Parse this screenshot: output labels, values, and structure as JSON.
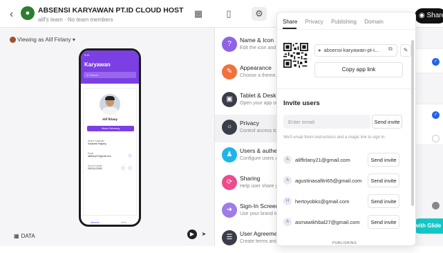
{
  "header": {
    "app_title": "ABSENSI KARYAWAN PT.ID CLOUD HOST",
    "app_subtitle": "alif's team · No team members",
    "publish_label": "Share"
  },
  "viewer": {
    "viewing_as": "Viewing as Alif Firlany"
  },
  "phone": {
    "time": "9:41",
    "screen_title": "Karyawan",
    "search_placeholder": "Search",
    "employee_name": "Alif firlany",
    "action_button": "Absen Sekarang",
    "rows": [
      {
        "label": "Status Karyawan",
        "value": "Karyawan Magang"
      },
      {
        "label": "Email",
        "value": "aliffirlany21@gmail.com"
      },
      {
        "label": "Nomor Kontak",
        "value": "082341129262"
      }
    ],
    "nav": [
      "Absensi",
      "Akun"
    ]
  },
  "bottom_left": {
    "data_label": "DATA"
  },
  "settings_menu": [
    {
      "title": "Name & Icon",
      "subtitle": "Edit the icon and d",
      "icon": "help-icon",
      "color": "#8e63e6"
    },
    {
      "title": "Appearance",
      "subtitle": "Choose a theme, c",
      "icon": "brush-icon",
      "color": "#f0713d"
    },
    {
      "title": "Tablet & Deskto",
      "subtitle": "Open your app on",
      "icon": "chat-icon",
      "color": "#3b3d4a"
    },
    {
      "title": "Privacy",
      "subtitle": "Control access to y",
      "icon": "lock-icon",
      "color": "#3b3d4a"
    },
    {
      "title": "Users & authent",
      "subtitle": "Configure users an",
      "icon": "users-icon",
      "color": "#1fb5e8"
    },
    {
      "title": "Sharing",
      "subtitle": "Help user share yo",
      "icon": "share-icon",
      "color": "#ec4b8c"
    },
    {
      "title": "Sign-In Screen",
      "subtitle": "Use your brand to",
      "icon": "signin-icon",
      "color": "#9f7ce8"
    },
    {
      "title": "User Agreement",
      "subtitle": "Create terms and c",
      "icon": "document-icon",
      "color": "#3b3d4a"
    }
  ],
  "share_panel": {
    "tabs": [
      "Share",
      "Privacy",
      "Publishing",
      "Domain"
    ],
    "url": "absensi-karyawan-pt-i...",
    "copy_label": "Copy app link",
    "invite_title": "Invite users",
    "email_placeholder": "Enter email",
    "send_label": "Send invite",
    "invite_note": "We'll email them instructions and a magic link to sign in.",
    "users": [
      {
        "initial": "A",
        "email": "aliffirlany21@gmail.com",
        "button": "Send invite"
      },
      {
        "initial": "A",
        "email": "agustinasafitri65@gmail.com",
        "button": "Send invite"
      },
      {
        "initial": "H",
        "email": "hertoyobks@gmail.com",
        "button": "Send invite"
      },
      {
        "initial": "A",
        "email": "asmawikhbal27@gmail.com",
        "button": "Send invite"
      }
    ],
    "publishing_peek": "PUBLISHING"
  },
  "right_panel": {
    "peek_text": "in",
    "glide_label": "with Glide"
  },
  "colors": {
    "accent": "#7b3fe4",
    "check": "#2563eb",
    "glide": "#14c7c7"
  }
}
